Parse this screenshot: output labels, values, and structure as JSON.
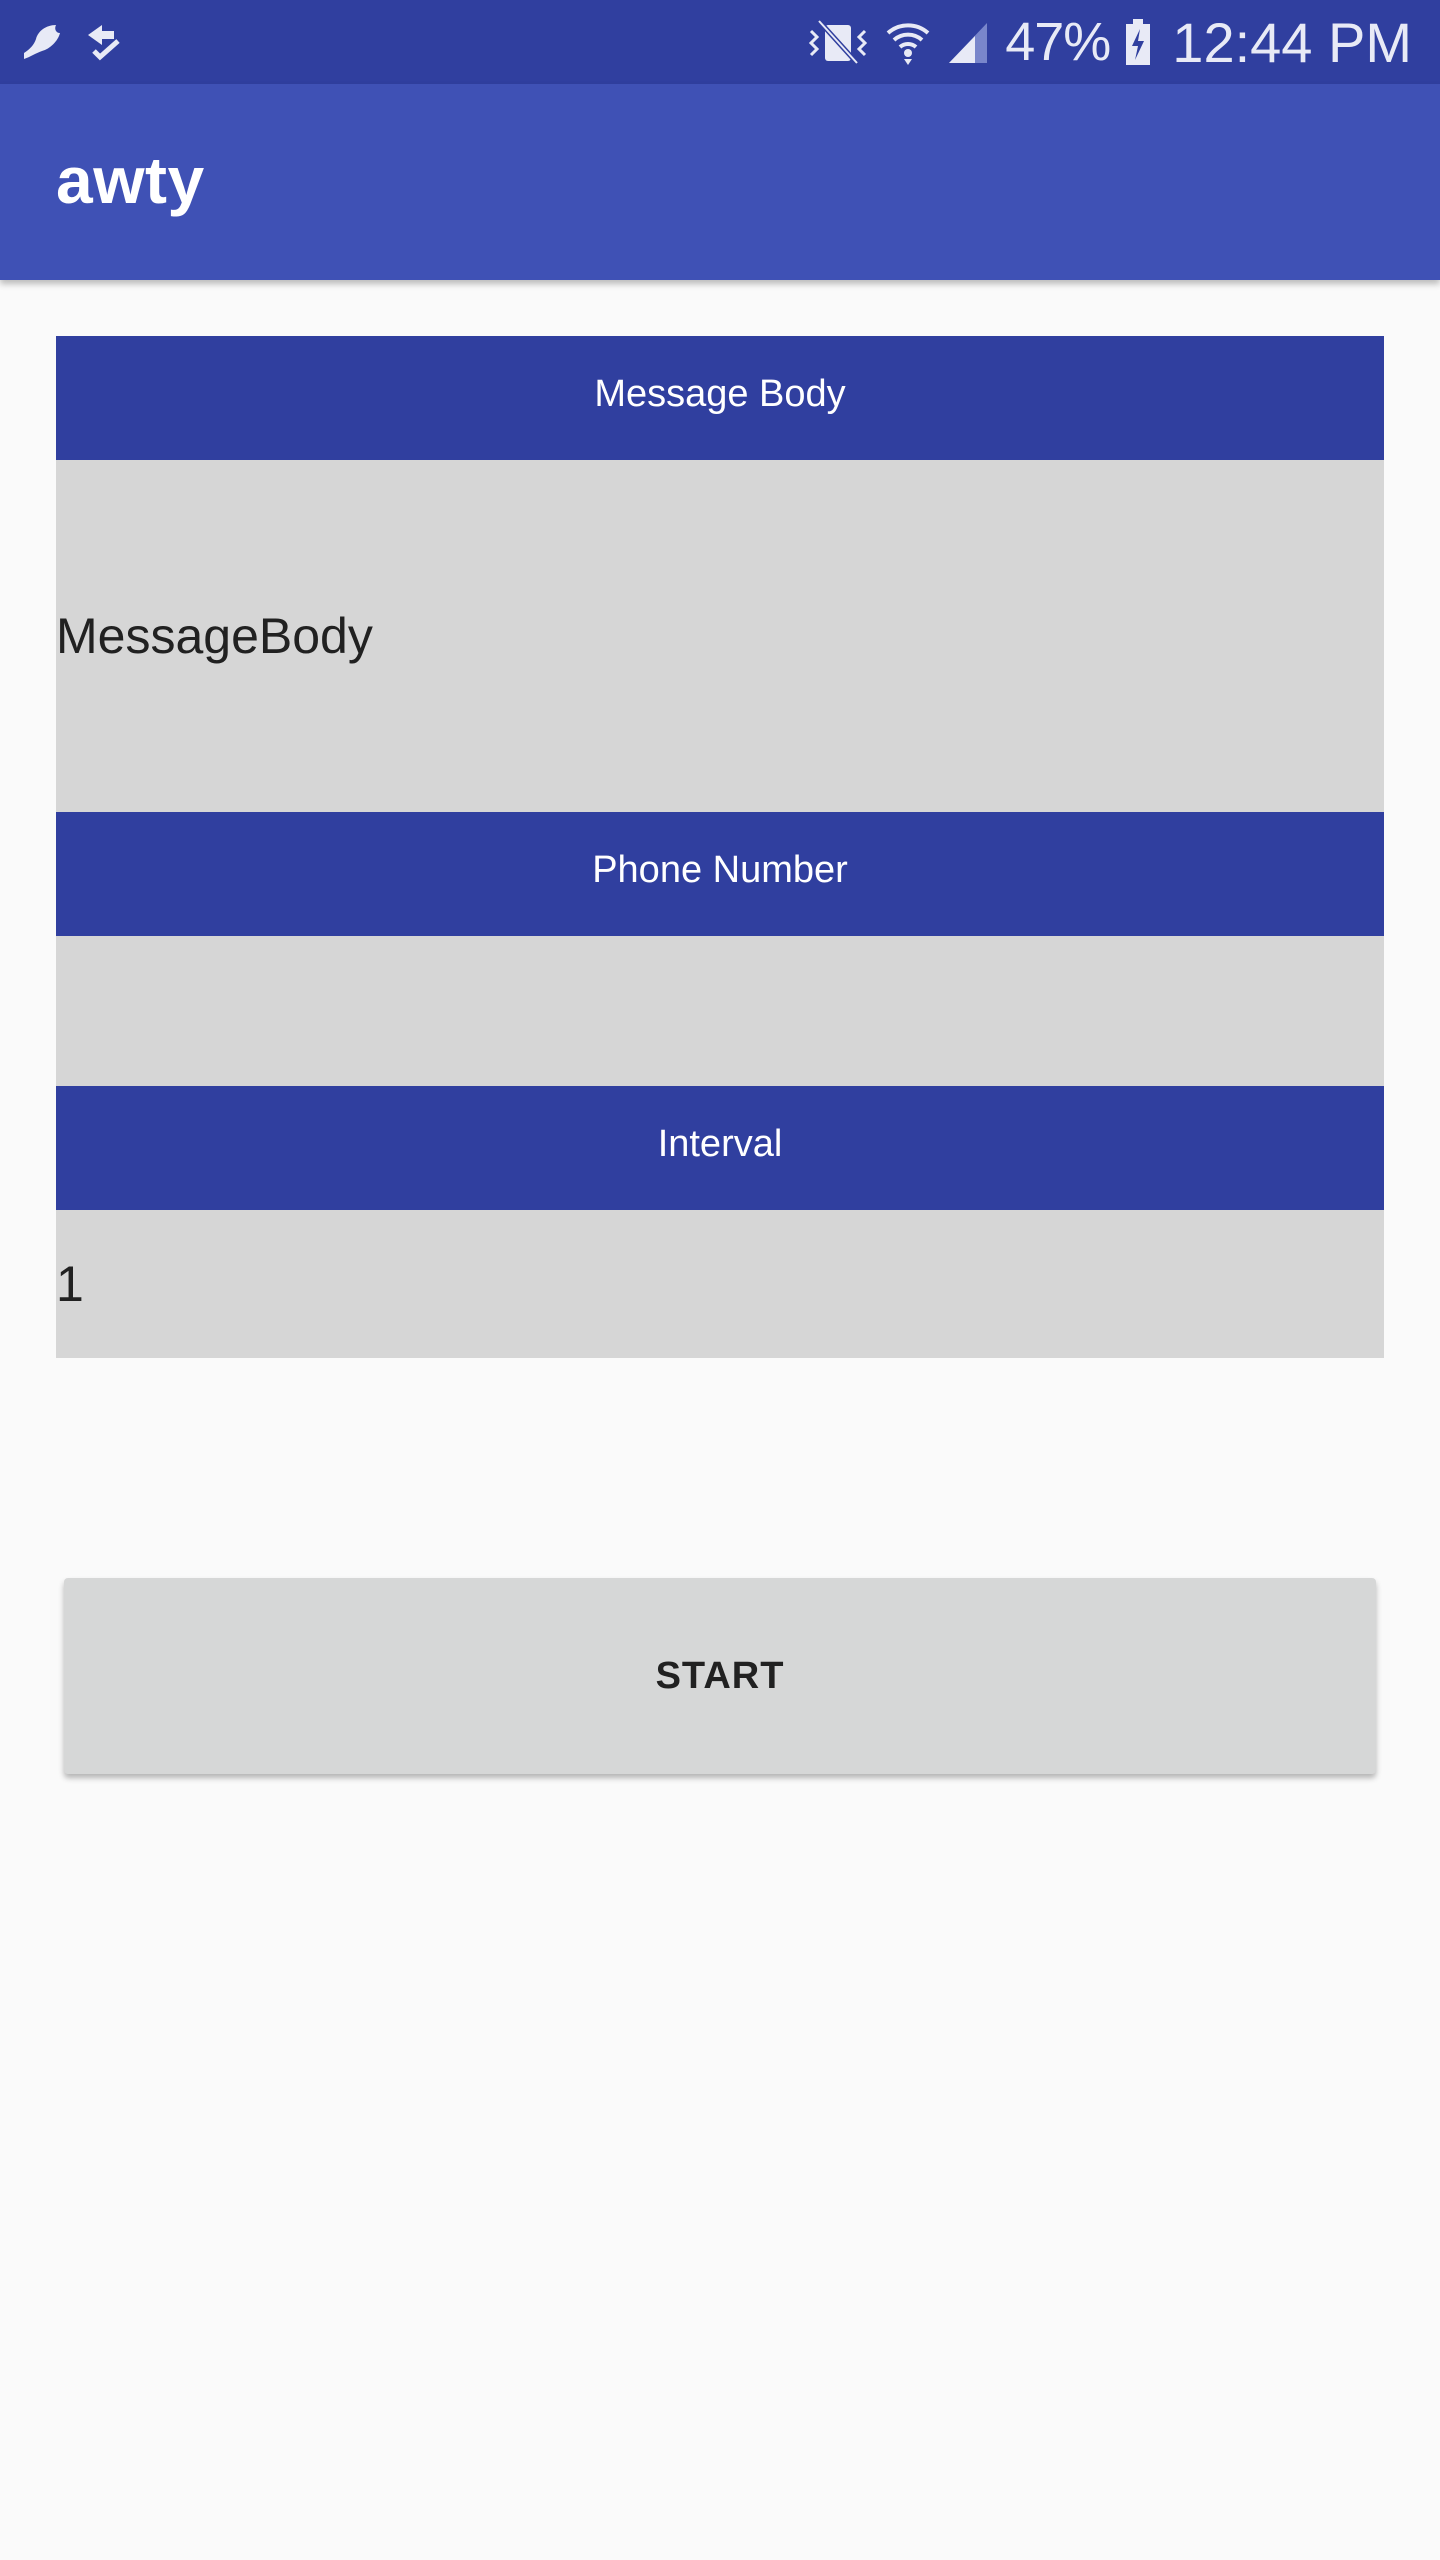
{
  "status_bar": {
    "left_icons": [
      "app-notification-icon",
      "sync-check-icon"
    ],
    "right_icons": [
      "vibrate-mute-icon",
      "wifi-icon",
      "cell-signal-icon",
      "battery-charging-icon"
    ],
    "battery_percent": "47%",
    "time": "12:44 PM"
  },
  "app_bar": {
    "title": "awty"
  },
  "form": {
    "message_body": {
      "header": "Message Body",
      "value": "MessageBody"
    },
    "phone_number": {
      "header": "Phone Number",
      "value": ""
    },
    "interval": {
      "header": "Interval",
      "value": "1"
    }
  },
  "start_button": {
    "label": "START"
  },
  "colors": {
    "status_bar": "#303f9f",
    "app_bar": "#3f51b5",
    "section_header": "#303f9f",
    "field_background": "#d6d6d6",
    "page_background": "#fafafa",
    "button_background": "#d6d7d7"
  }
}
